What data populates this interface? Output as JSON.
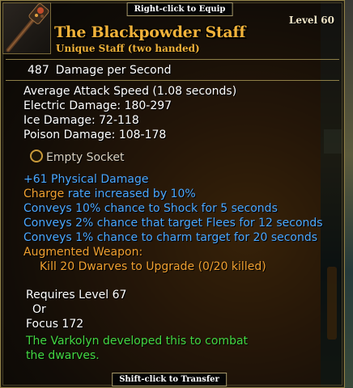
{
  "hints": {
    "equip": "Right-click to Equip",
    "transfer": "Shift-click to Transfer"
  },
  "item": {
    "name": "The Blackpowder Staff",
    "subtitle": "Unique Staff (two handed)",
    "level_label": "Level 60",
    "icon": "staff-icon"
  },
  "stats": {
    "dps_value": "487",
    "dps_label": "Damage per Second",
    "lines": [
      "Average Attack Speed (1.08 seconds)",
      "Electric Damage: 180-297",
      "Ice Damage: 72-118",
      "Poison Damage: 108-178"
    ]
  },
  "socket": {
    "label": "Empty Socket",
    "icon": "socket-ring-icon"
  },
  "enchantments": {
    "physical": "+61 Physical Damage",
    "charge_word": "Charge",
    "charge_rest": " rate increased by 10%",
    "effects": [
      "Conveys 10% chance to Shock for 5 seconds",
      "Conveys 2% chance that target Flees for 12 seconds",
      "Conveys 1% chance to charm target for 20 seconds"
    ]
  },
  "augmented": {
    "title": "Augmented Weapon:",
    "task": "Kill 20 Dwarves to Upgrade (0/20 killed)"
  },
  "requirements": {
    "level": "Requires Level 67",
    "or": "Or",
    "focus": "Focus 172"
  },
  "lore": {
    "line1": "The Varkolyn developed this to combat",
    "line2": "the dwarves."
  },
  "colors": {
    "title_gold": "#f0b23a",
    "enchant_blue": "#4aa8ff",
    "charge_orange": "#f0a030",
    "lore_green": "#43d843",
    "border_gold": "#8f8048"
  }
}
